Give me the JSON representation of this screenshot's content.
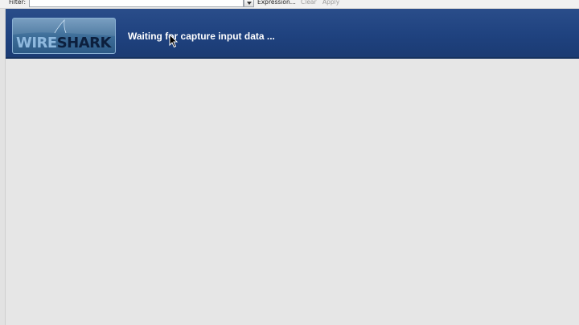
{
  "filter_toolbar": {
    "label": "Filter:",
    "input_value": "",
    "expression_label": "Expression...",
    "clear_label": "Clear",
    "apply_label": "Apply",
    "dropdown_icon": "chevron-down-icon"
  },
  "banner": {
    "logo_text_wire": "WIRE",
    "logo_text_shark": "SHARK",
    "status_message": "Waiting for capture input data ..."
  },
  "colors": {
    "banner_background": "#1f427f",
    "workspace_background": "#e6e6e6",
    "disabled_text": "#9a9a9a"
  }
}
